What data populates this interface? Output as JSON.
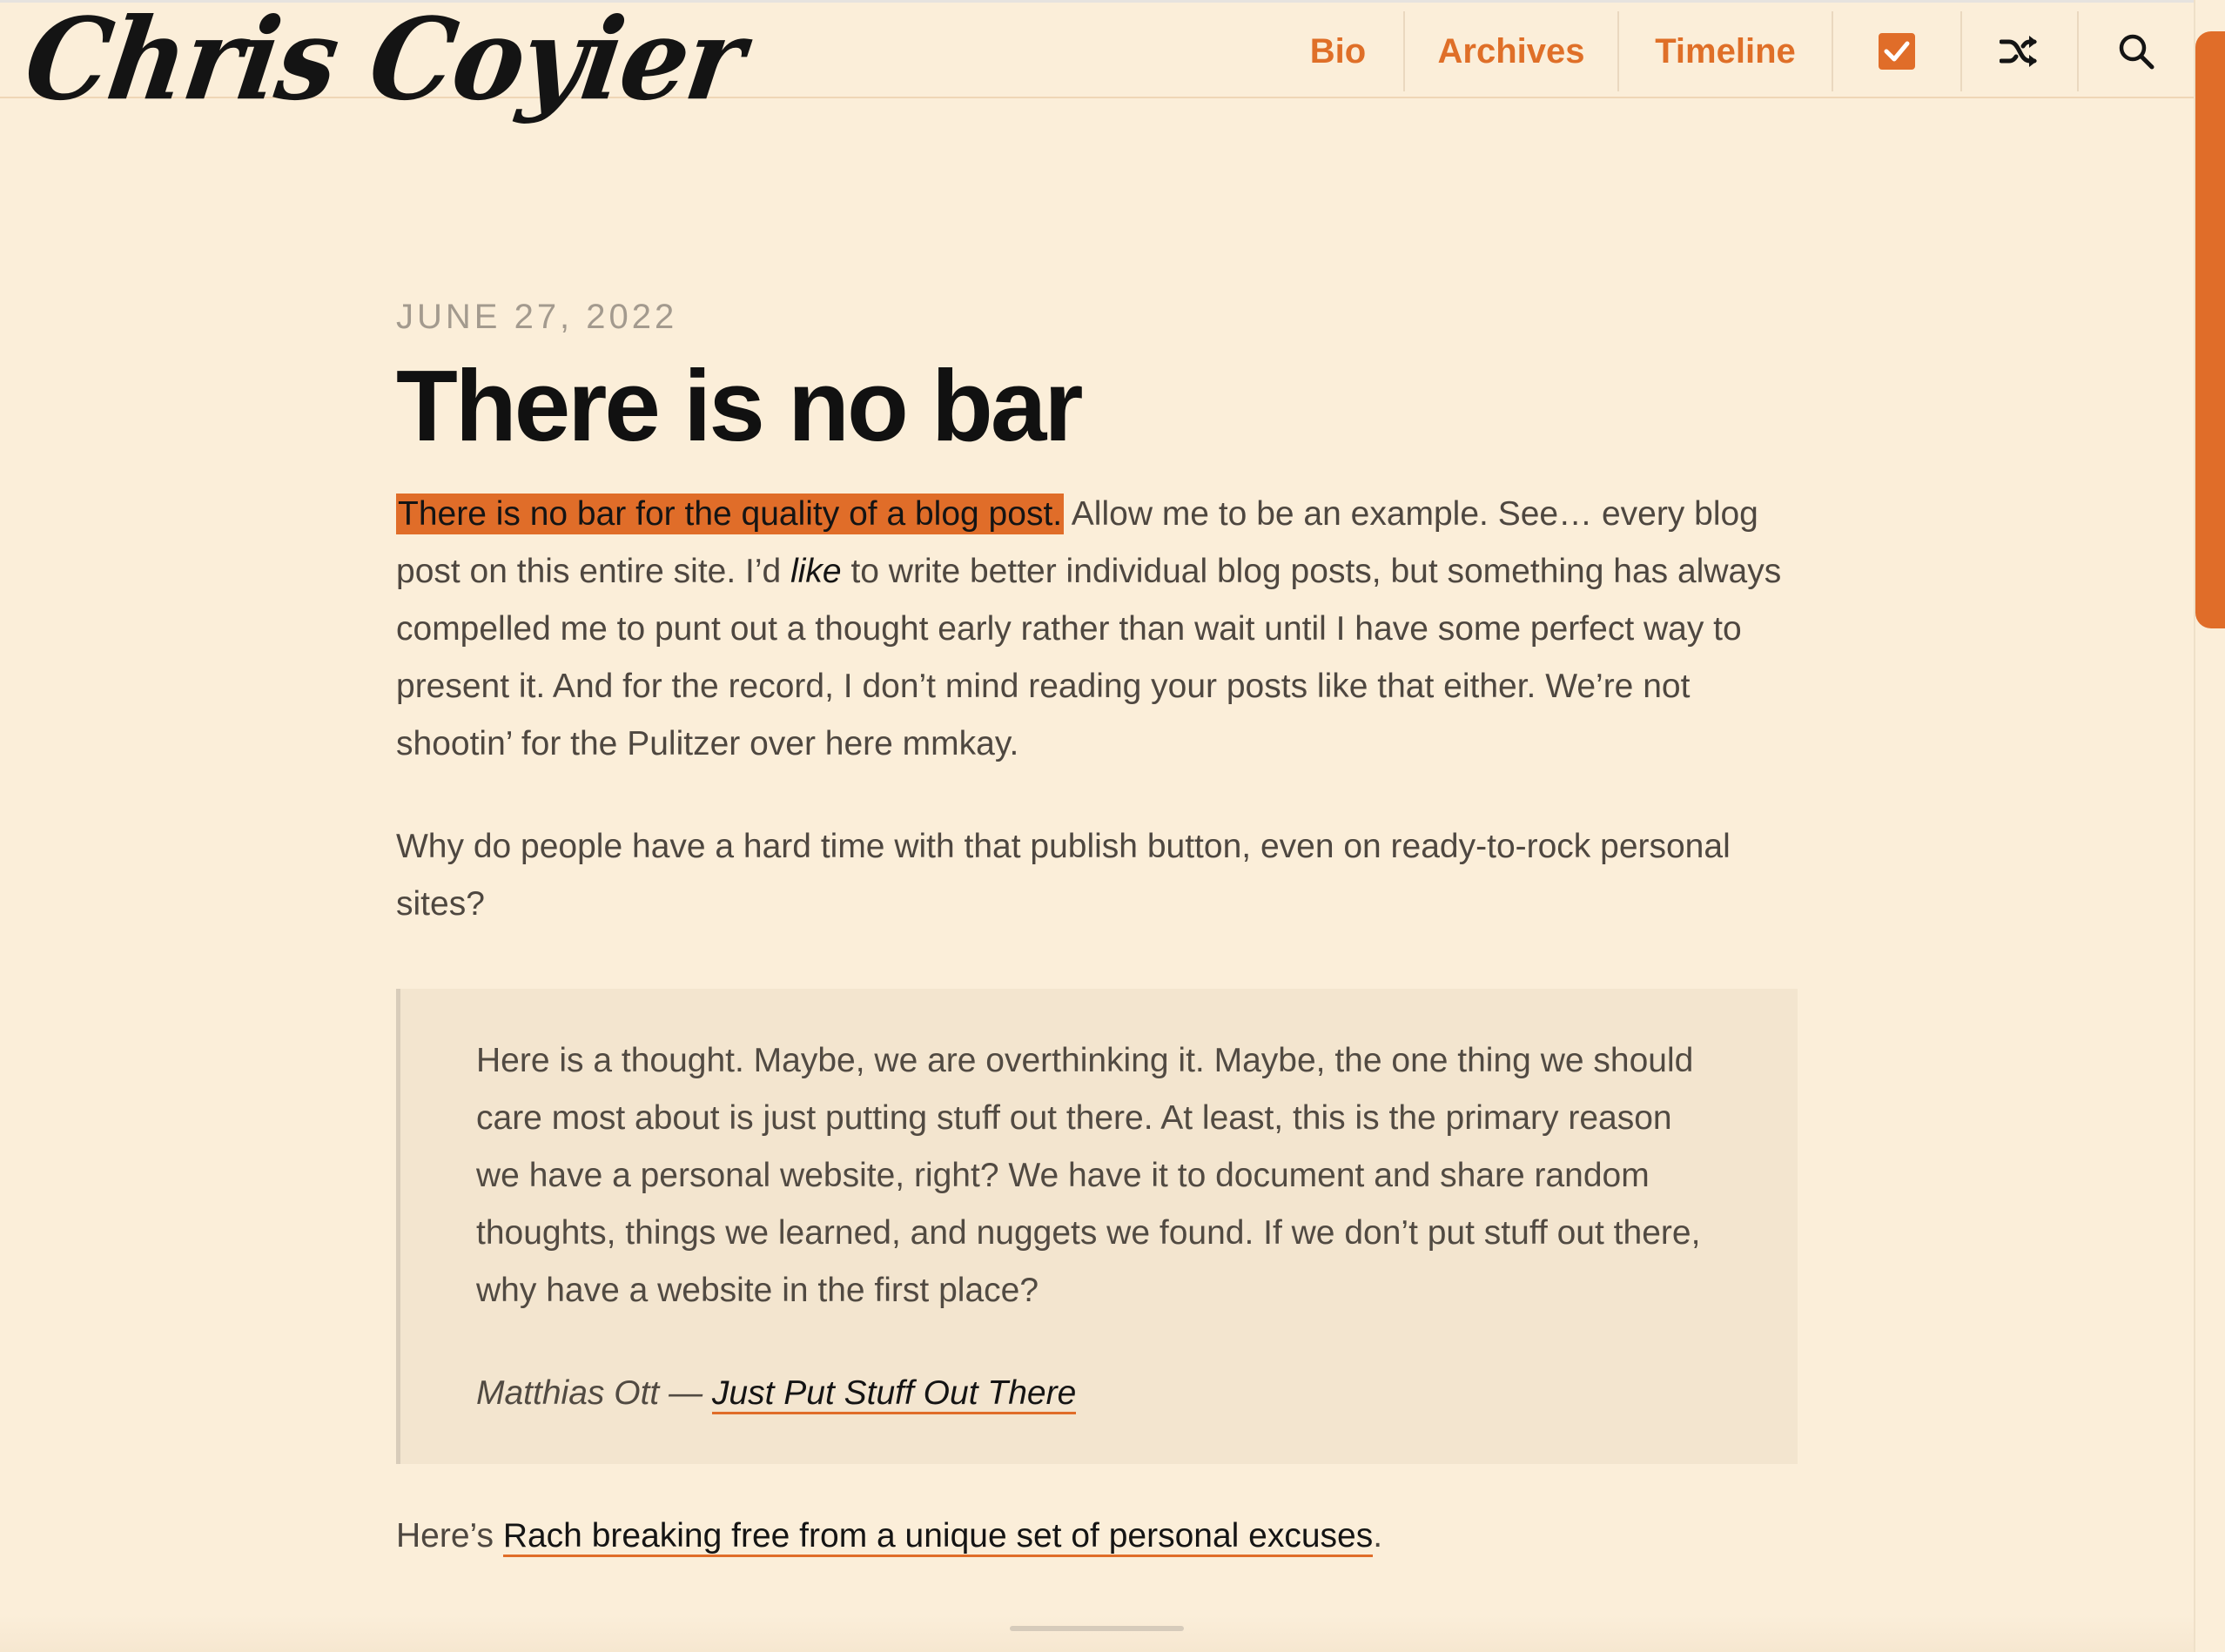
{
  "site": {
    "logo_text": "Chris Coyier"
  },
  "nav": {
    "bio": "Bio",
    "archives": "Archives",
    "timeline": "Timeline",
    "icons": [
      "checkbox-icon",
      "shuffle-icon",
      "search-icon"
    ]
  },
  "colors": {
    "accent": "#e06d29",
    "background": "#fbeed9",
    "quote_background": "#f3e5cf",
    "text": "#4e4740"
  },
  "post": {
    "date": "JUNE 27, 2022",
    "title": "There is no bar",
    "p1": {
      "highlight": "There is no bar for the quality of a blog post.",
      "text_a": " Allow me to be an example. See… every blog post on this entire site. I’d ",
      "em": "like",
      "text_b": " to write better individual blog posts, but something has always compelled me to punt out a thought early rather than wait until I have some perfect way to present it. And for the record, I don’t mind reading your posts like that either. We’re not shootin’ for the Pulitzer over here mmkay."
    },
    "p2": "Why do people have a hard time with that publish button, even on ready-to-rock personal sites?",
    "quote": {
      "text": "Here is a thought. Maybe, we are overthinking it. Maybe, the one thing we should care most about is just putting stuff out there. At least, this is the primary reason we have a personal website, right? We have it to document and share random thoughts, things we learned, and nuggets we found. If we don’t put stuff out there, why have a website in the first place?",
      "author": "Matthias Ott — ",
      "link_text": "Just Put Stuff Out There"
    },
    "p3": {
      "prefix": "Here’s ",
      "link_text": "Rach breaking free from a unique set of personal excuses",
      "suffix": "."
    }
  }
}
